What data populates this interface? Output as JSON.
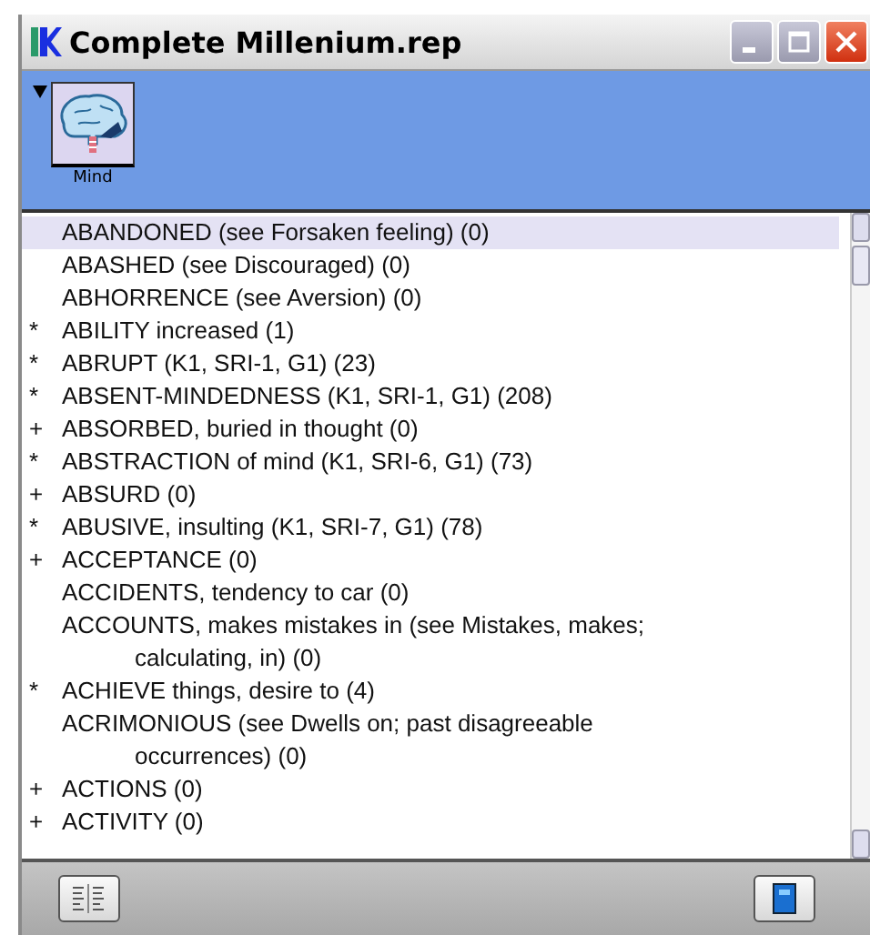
{
  "window": {
    "title": "Complete Millenium.rep"
  },
  "shelf": {
    "expanded": true,
    "items": [
      {
        "label": "Mind"
      }
    ]
  },
  "list": {
    "items": [
      {
        "text": "ABANDONED (see Forsaken feeling) (0)",
        "selected": true
      },
      {
        "text": "ABASHED (see Discouraged) (0)",
        "selected": false
      },
      {
        "text": "ABHORRENCE (see Aversion) (0)",
        "selected": false
      },
      {
        "marker": "*",
        "text": "ABILITY increased (1)",
        "selected": false
      },
      {
        "marker": "*",
        "text": "ABRUPT (K1, SRI-1, G1) (23)",
        "selected": false
      },
      {
        "marker": "*",
        "text": "ABSENT-MINDEDNESS (K1, SRI-1, G1) (208)",
        "selected": false
      },
      {
        "marker": "+",
        "text": "ABSORBED, buried in thought (0)",
        "selected": false
      },
      {
        "marker": "*",
        "text": "ABSTRACTION of mind (K1, SRI-6, G1) (73)",
        "selected": false
      },
      {
        "marker": "+",
        "text": "ABSURD (0)",
        "selected": false
      },
      {
        "marker": "*",
        "text": "ABUSIVE, insulting (K1, SRI-7, G1) (78)",
        "selected": false
      },
      {
        "marker": "+",
        "text": "ACCEPTANCE (0)",
        "selected": false
      },
      {
        "text": "ACCIDENTS, tendency to car (0)",
        "selected": false
      },
      {
        "text": "ACCOUNTS, makes mistakes in (see Mistakes, makes; calculating, in) (0)",
        "selected": false
      },
      {
        "marker": "*",
        "text": "ACHIEVE things, desire to (4)",
        "selected": false
      },
      {
        "text": "ACRIMONIOUS (see Dwells on; past disagreeable occurrences) (0)",
        "selected": false
      },
      {
        "marker": "+",
        "text": "ACTIONS (0)",
        "selected": false
      },
      {
        "marker": "+",
        "text": "ACTIVITY (0)",
        "selected": false
      }
    ]
  }
}
